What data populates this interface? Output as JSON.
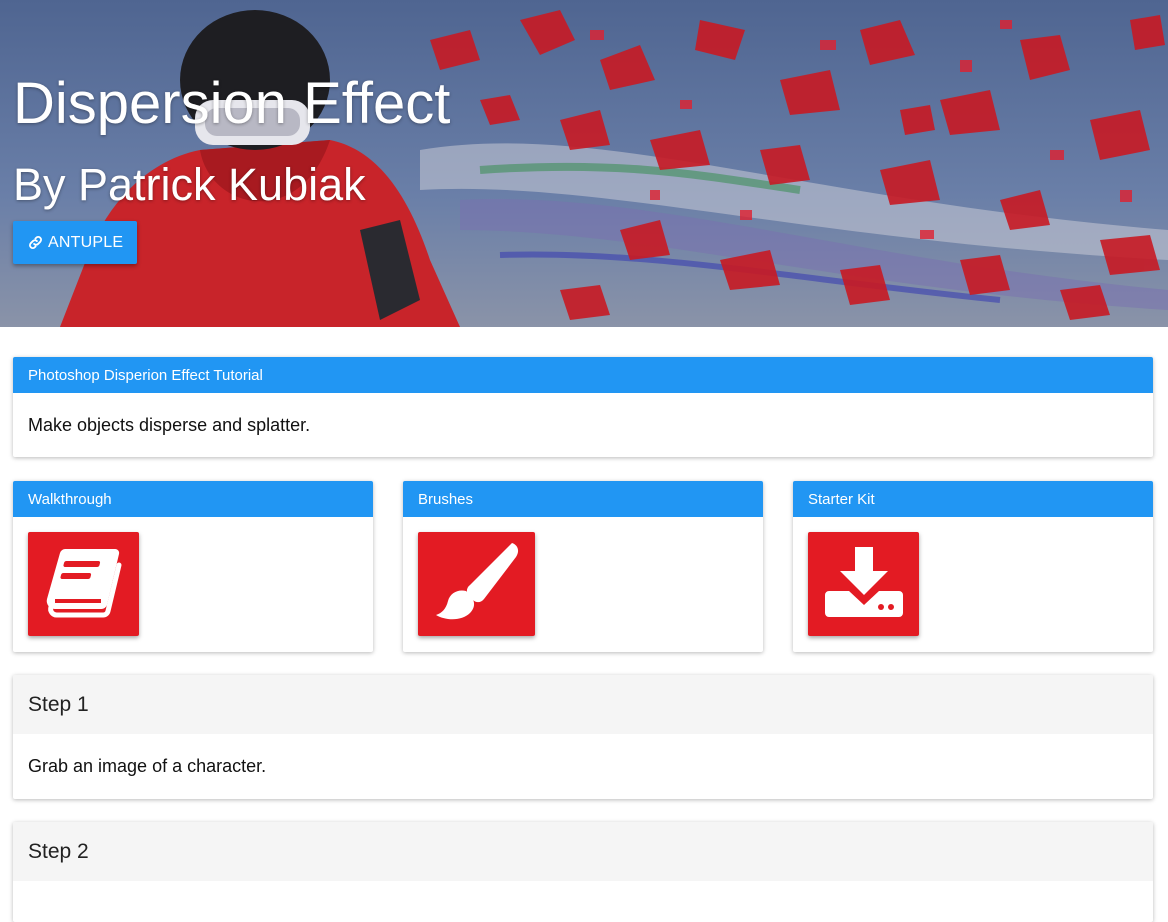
{
  "hero": {
    "title": "Dispersion Effect",
    "subtitle": "By Patrick Kubiak",
    "button_label": "ANTUPLE",
    "button_icon": "link-icon"
  },
  "intro": {
    "header": "Photoshop Disperion Effect Tutorial",
    "body": "Make objects disperse and splatter."
  },
  "resources": [
    {
      "header": "Walkthrough",
      "icon": "book-icon"
    },
    {
      "header": "Brushes",
      "icon": "paintbrush-icon"
    },
    {
      "header": "Starter Kit",
      "icon": "download-icon"
    }
  ],
  "steps": [
    {
      "title": "Step 1",
      "body": "Grab an image of a character."
    },
    {
      "title": "Step 2",
      "body": ""
    }
  ],
  "colors": {
    "primary": "#2196f3",
    "accent": "#e31b23",
    "step_header_bg": "#f5f5f5"
  }
}
